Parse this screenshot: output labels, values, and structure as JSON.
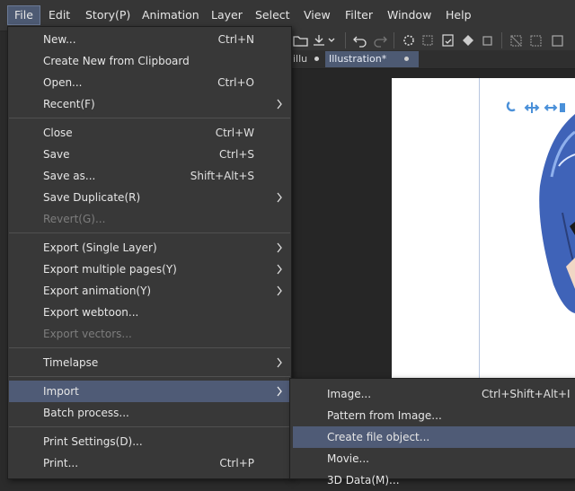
{
  "menubar": {
    "items": [
      "File",
      "Edit",
      "Story(P)",
      "Animation",
      "Layer",
      "Select",
      "View",
      "Filter",
      "Window",
      "Help"
    ]
  },
  "tabs": [
    {
      "label": "illu"
    },
    {
      "label": "Illustration*"
    }
  ],
  "file_menu": {
    "items": [
      {
        "label": "New...",
        "shortcut": "Ctrl+N"
      },
      {
        "label": "Create New from Clipboard",
        "shortcut": ""
      },
      {
        "label": "Open...",
        "shortcut": "Ctrl+O"
      },
      {
        "label": "Recent(F)",
        "shortcut": ""
      },
      {
        "label": "Close",
        "shortcut": "Ctrl+W"
      },
      {
        "label": "Save",
        "shortcut": "Ctrl+S"
      },
      {
        "label": "Save as...",
        "shortcut": "Shift+Alt+S"
      },
      {
        "label": "Save Duplicate(R)",
        "shortcut": ""
      },
      {
        "label": "Revert(G)...",
        "shortcut": ""
      },
      {
        "label": "Export (Single Layer)",
        "shortcut": ""
      },
      {
        "label": "Export multiple pages(Y)",
        "shortcut": ""
      },
      {
        "label": "Export animation(Y)",
        "shortcut": ""
      },
      {
        "label": "Export webtoon...",
        "shortcut": ""
      },
      {
        "label": "Export vectors...",
        "shortcut": ""
      },
      {
        "label": "Timelapse",
        "shortcut": ""
      },
      {
        "label": "Import",
        "shortcut": ""
      },
      {
        "label": "Batch process...",
        "shortcut": ""
      },
      {
        "label": "Print Settings(D)...",
        "shortcut": ""
      },
      {
        "label": "Print...",
        "shortcut": "Ctrl+P"
      }
    ]
  },
  "import_submenu": {
    "items": [
      {
        "label": "Image...",
        "shortcut": "Ctrl+Shift+Alt+I"
      },
      {
        "label": "Pattern from Image...",
        "shortcut": ""
      },
      {
        "label": "Create file object...",
        "shortcut": ""
      },
      {
        "label": "Movie...",
        "shortcut": ""
      },
      {
        "label": "3D Data(M)...",
        "shortcut": ""
      }
    ]
  },
  "colors": {
    "highlight": "#4f5b76",
    "menu_bg": "#383838",
    "hair_blue": "#3f63b8"
  }
}
